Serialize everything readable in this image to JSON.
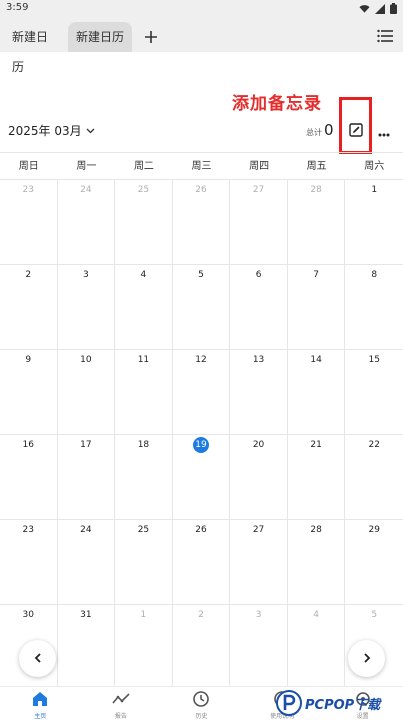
{
  "status_bar": {
    "time": "3:59"
  },
  "tabs": [
    {
      "label": "新建日历"
    },
    {
      "label": "新建日历"
    }
  ],
  "annotation": {
    "text": "添加备忘录"
  },
  "header": {
    "month": "2025年 03月",
    "total_label": "总计",
    "total_value": "0"
  },
  "weekdays": [
    "周日",
    "周一",
    "周二",
    "周三",
    "周四",
    "周五",
    "周六"
  ],
  "calendar": {
    "days": [
      {
        "d": "23",
        "other": true
      },
      {
        "d": "24",
        "other": true
      },
      {
        "d": "25",
        "other": true
      },
      {
        "d": "26",
        "other": true
      },
      {
        "d": "27",
        "other": true
      },
      {
        "d": "28",
        "other": true
      },
      {
        "d": "1",
        "other": false
      },
      {
        "d": "2",
        "other": false
      },
      {
        "d": "3",
        "other": false
      },
      {
        "d": "4",
        "other": false
      },
      {
        "d": "5",
        "other": false
      },
      {
        "d": "6",
        "other": false
      },
      {
        "d": "7",
        "other": false
      },
      {
        "d": "8",
        "other": false
      },
      {
        "d": "9",
        "other": false
      },
      {
        "d": "10",
        "other": false
      },
      {
        "d": "11",
        "other": false
      },
      {
        "d": "12",
        "other": false
      },
      {
        "d": "13",
        "other": false
      },
      {
        "d": "14",
        "other": false
      },
      {
        "d": "15",
        "other": false
      },
      {
        "d": "16",
        "other": false
      },
      {
        "d": "17",
        "other": false
      },
      {
        "d": "18",
        "other": false
      },
      {
        "d": "19",
        "other": false,
        "today": true
      },
      {
        "d": "20",
        "other": false
      },
      {
        "d": "21",
        "other": false
      },
      {
        "d": "22",
        "other": false
      },
      {
        "d": "23",
        "other": false
      },
      {
        "d": "24",
        "other": false
      },
      {
        "d": "25",
        "other": false
      },
      {
        "d": "26",
        "other": false
      },
      {
        "d": "27",
        "other": false
      },
      {
        "d": "28",
        "other": false
      },
      {
        "d": "29",
        "other": false
      },
      {
        "d": "30",
        "other": false
      },
      {
        "d": "31",
        "other": false
      },
      {
        "d": "1",
        "other": true
      },
      {
        "d": "2",
        "other": true
      },
      {
        "d": "3",
        "other": true
      },
      {
        "d": "4",
        "other": true
      },
      {
        "d": "5",
        "other": true
      }
    ]
  },
  "nav": {
    "prev": "‹",
    "next": "›"
  },
  "bottom_nav": [
    {
      "label": "主页",
      "icon": "home-icon",
      "active": true
    },
    {
      "label": "报告",
      "icon": "trend-icon",
      "active": false
    },
    {
      "label": "历史",
      "icon": "clock-icon",
      "active": false
    },
    {
      "label": "使用说明",
      "icon": "help-icon",
      "active": false
    },
    {
      "label": "设置",
      "icon": "settings-icon",
      "active": false
    }
  ],
  "watermark": {
    "text": "PCPOP下载"
  },
  "colors": {
    "accent": "#1e7be0",
    "annotation": "#e62d2d"
  }
}
